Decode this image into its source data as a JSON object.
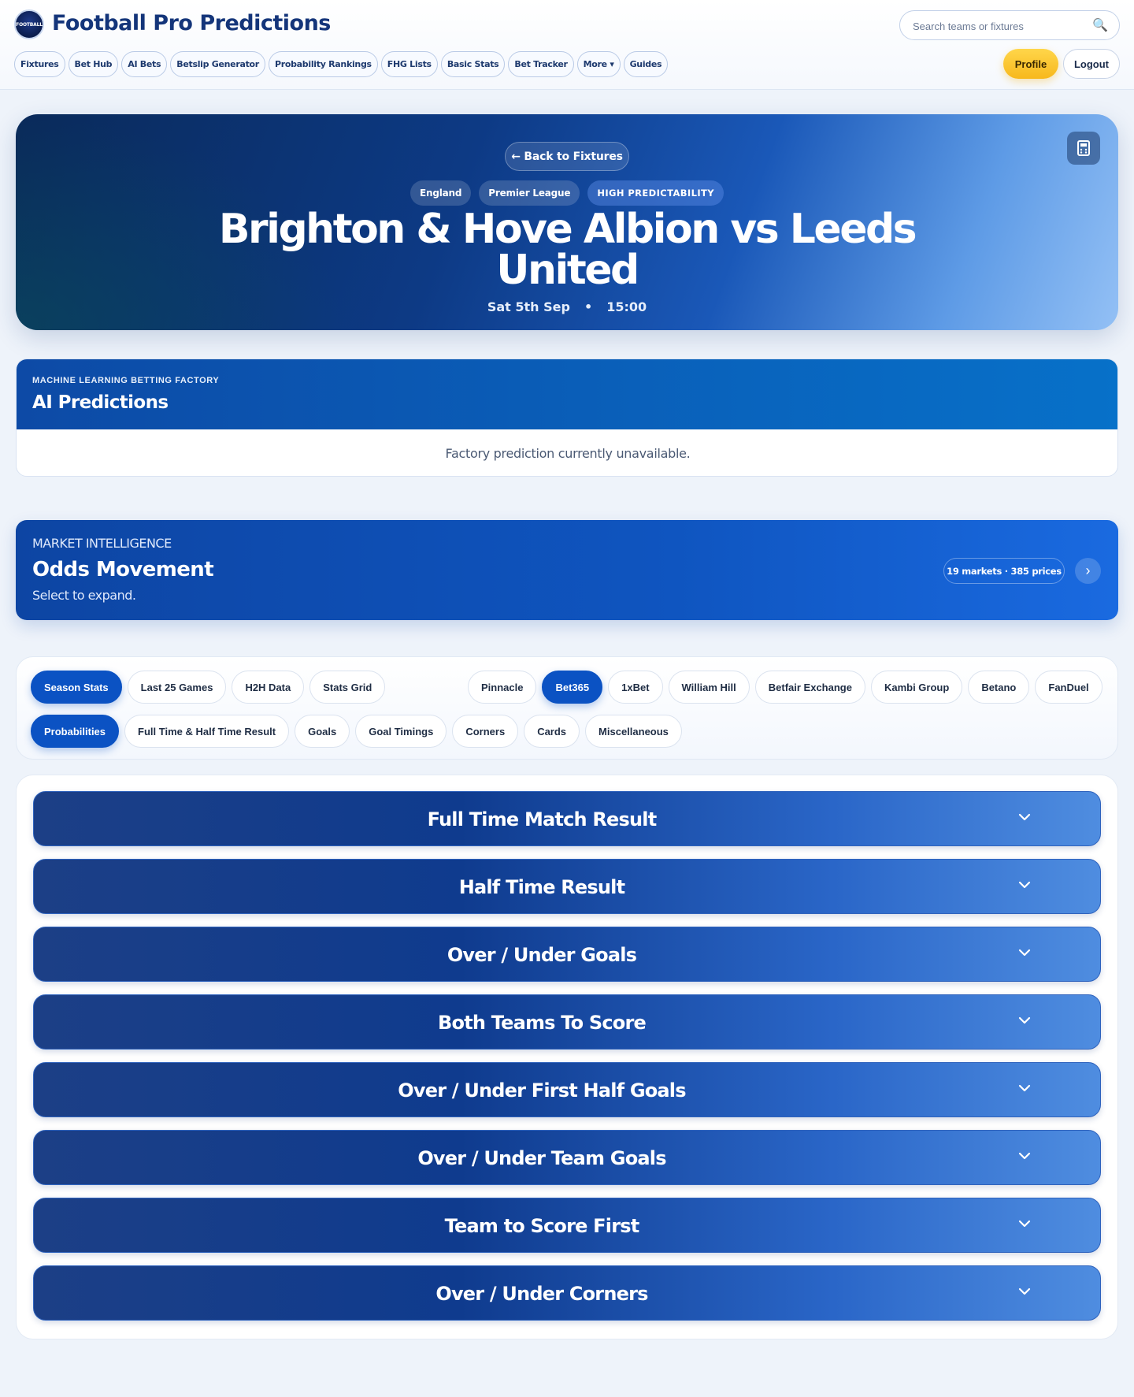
{
  "header": {
    "logo_text": "FOOTBALL",
    "title": "Football Pro Predictions",
    "search_placeholder": "Search teams or fixtures",
    "nav": [
      "Fixtures",
      "Bet Hub",
      "AI Bets",
      "Betslip Generator",
      "Probability Rankings",
      "FHG Lists",
      "Basic Stats",
      "Bet Tracker",
      "More ▾",
      "Guides"
    ],
    "profile_label": "Profile",
    "logout_label": "Logout"
  },
  "hero": {
    "back_label": "← Back to Fixtures",
    "country": "England",
    "league": "Premier League",
    "predictability": "HIGH PREDICTABILITY",
    "title_line1": "Brighton & Hove Albion vs Leeds",
    "title_line2": "United",
    "date": "Sat 5th Sep",
    "separator": "•",
    "time": "15:00"
  },
  "ai": {
    "kicker": "MACHINE LEARNING BETTING FACTORY",
    "title": "AI Predictions",
    "message": "Factory prediction currently unavailable."
  },
  "odds": {
    "kicker": "MARKET INTELLIGENCE",
    "title": "Odds Movement",
    "subtitle": "Select to expand.",
    "summary": "19 markets · 385 prices",
    "arrow": "›"
  },
  "filters": {
    "view_tabs": [
      "Season Stats",
      "Last 25 Games",
      "H2H Data",
      "Stats Grid"
    ],
    "view_active": 0,
    "bookmakers": [
      "Pinnacle",
      "Bet365",
      "1xBet",
      "William Hill",
      "Betfair Exchange",
      "Kambi Group",
      "Betano",
      "FanDuel"
    ],
    "bookmaker_active": 1,
    "market_tabs": [
      "Probabilities",
      "Full Time & Half Time Result",
      "Goals",
      "Goal Timings",
      "Corners",
      "Cards",
      "Miscellaneous"
    ],
    "market_active": 0
  },
  "accordion": [
    "Full Time Match Result",
    "Half Time Result",
    "Over / Under Goals",
    "Both Teams To Score",
    "Over / Under First Half Goals",
    "Over / Under Team Goals",
    "Team to Score First",
    "Over / Under Corners"
  ]
}
